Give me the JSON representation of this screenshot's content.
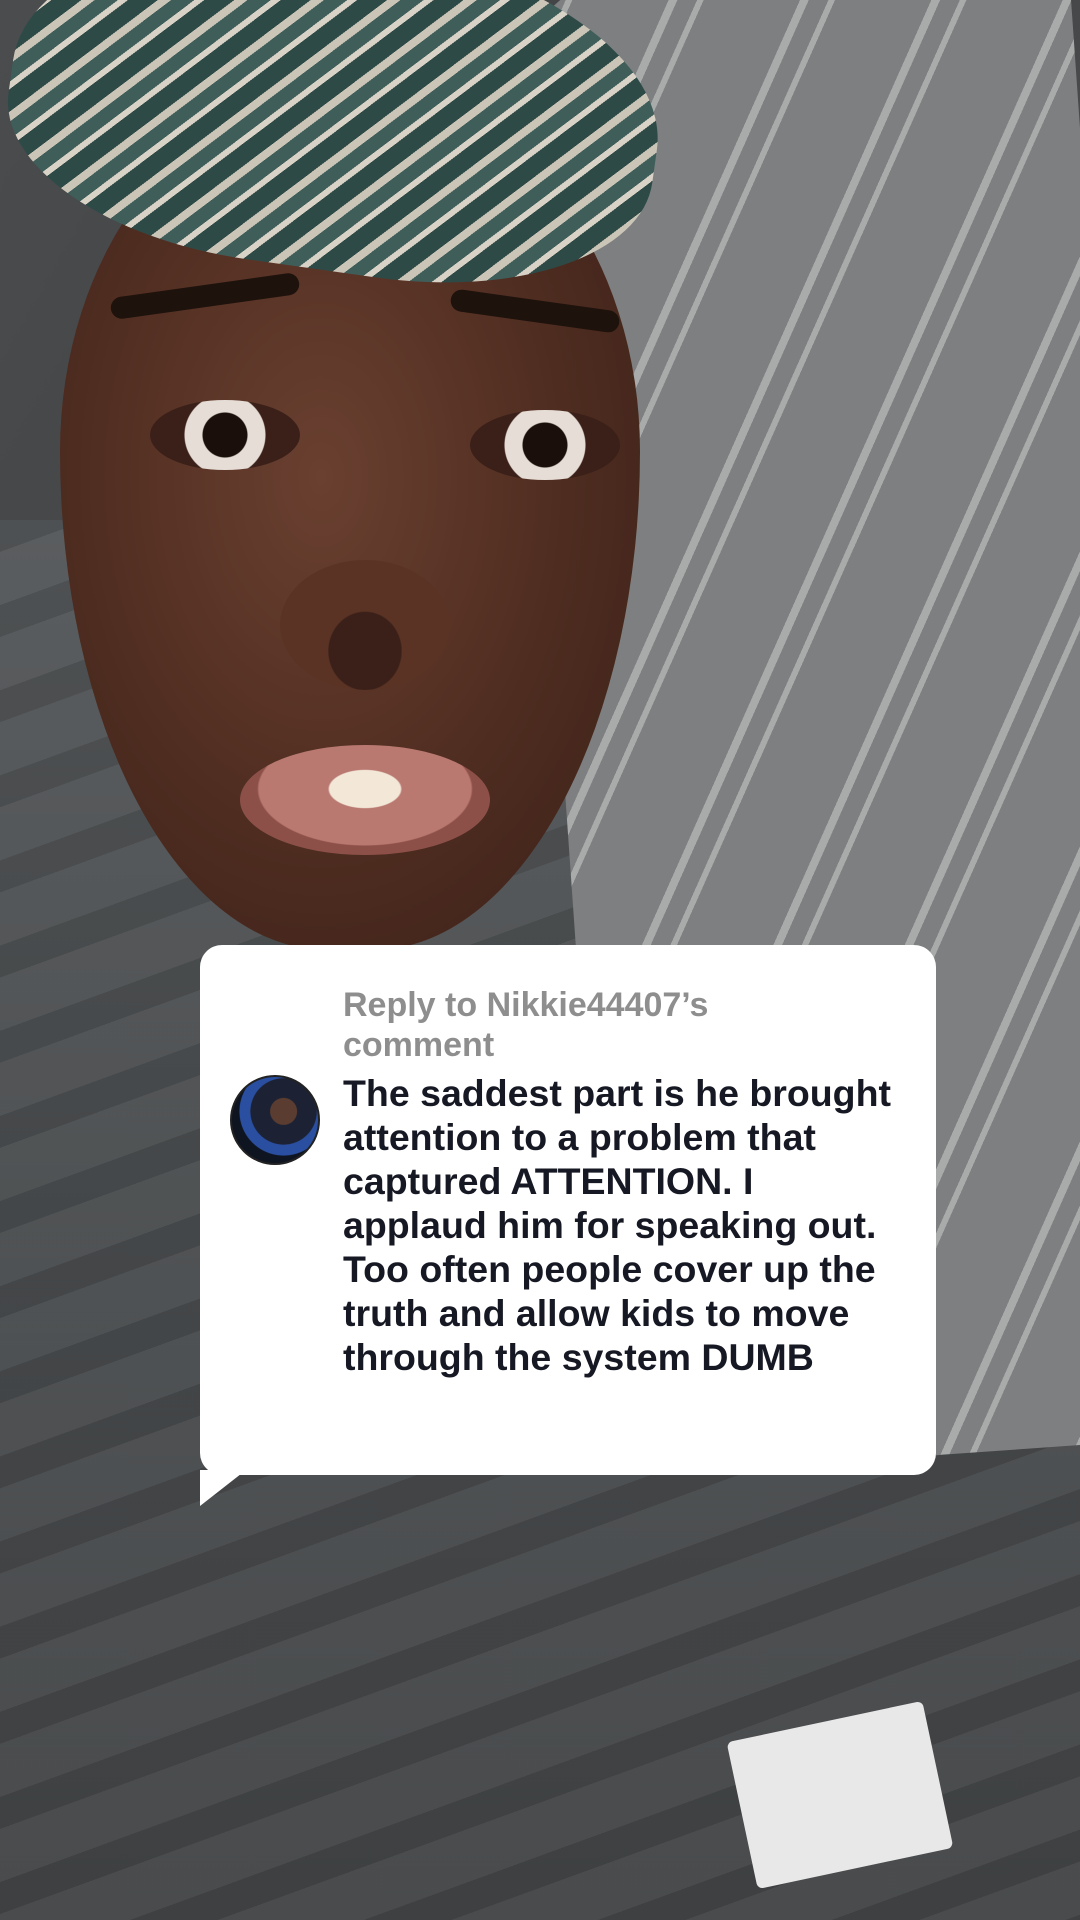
{
  "comment_reply": {
    "reply_prefix": "Reply to Nikkie44407’s",
    "reply_suffix": "comment",
    "text": "The saddest part is he brought attention to a problem that captured ATTENTION. I applaud him for speaking out. Too often people cover up the truth and allow kids to move through the system DUMB"
  },
  "colors": {
    "card_background": "#ffffff",
    "reply_gray": "#8e8e8e",
    "comment_text": "#161823"
  }
}
